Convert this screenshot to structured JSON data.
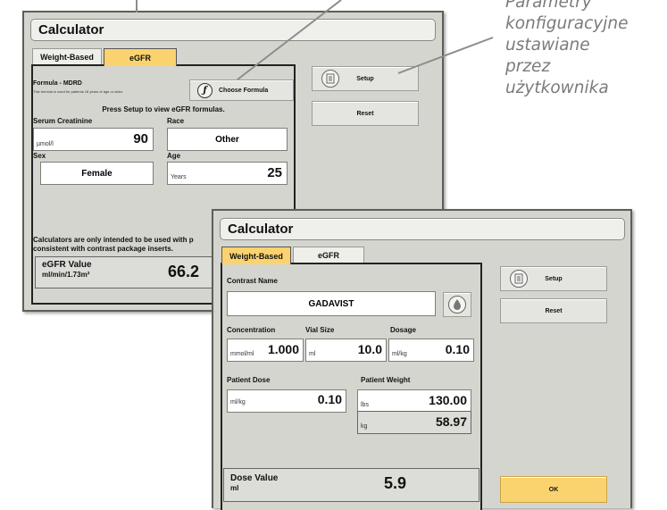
{
  "annotation": {
    "lines": [
      "Parametry",
      "konfiguracyjne",
      "ustawiane",
      "przez",
      "użytkownika"
    ]
  },
  "egfr_window": {
    "title": "Calculator",
    "tabs": [
      "Weight-Based",
      "eGFR"
    ],
    "active_tab": "eGFR",
    "formula_title": "Formula - MDRD",
    "formula_note": "This formula is used for patients 18 years of age or older.",
    "choose_formula_label": "Choose Formula",
    "choose_formula_icon": "function-icon",
    "setup_hint": "Press Setup to view eGFR formulas.",
    "serum_creatinine": {
      "label": "Serum Creatinine",
      "unit": "µmol/l",
      "value": "90"
    },
    "race": {
      "label": "Race",
      "value": "Other"
    },
    "sex": {
      "label": "Sex",
      "value": "Female"
    },
    "age": {
      "label": "Age",
      "unit": "Years",
      "value": "25"
    },
    "disclaimer_line1": "Calculators are only intended to be used with p",
    "disclaimer_line2": "consistent with contrast package inserts.",
    "result_label": "eGFR Value",
    "result_unit": "ml/min/1.73m²",
    "result_value": "66.2",
    "setup_label": "Setup",
    "reset_label": "Reset",
    "setup_icon": "list-icon"
  },
  "weight_window": {
    "title": "Calculator",
    "tabs": [
      "Weight-Based",
      "eGFR"
    ],
    "active_tab": "Weight-Based",
    "contrast_name_label": "Contrast Name",
    "contrast_name_value": "GADAVIST",
    "drop_icon": "drop-icon",
    "concentration": {
      "label": "Concentration",
      "unit": "mmol/ml",
      "value": "1.000"
    },
    "vial_size": {
      "label": "Vial Size",
      "unit": "ml",
      "value": "10.0"
    },
    "dosage": {
      "label": "Dosage",
      "unit": "ml/kg",
      "value": "0.10"
    },
    "patient_dose": {
      "label": "Patient Dose",
      "unit": "ml/kg",
      "value": "0.10"
    },
    "patient_weight": {
      "label": "Patient Weight",
      "unit_lbs": "lbs",
      "value_lbs": "130.00",
      "unit_kg": "kg",
      "value_kg": "58.97"
    },
    "result_label": "Dose Value",
    "result_unit": "ml",
    "result_value": "5.9",
    "setup_label": "Setup",
    "reset_label": "Reset",
    "ok_label": "OK",
    "setup_icon": "list-icon"
  },
  "colors": {
    "active_tab": "#fbd36e",
    "window_bg": "#d5d5d0",
    "annotation_text": "#7b7b7b"
  }
}
